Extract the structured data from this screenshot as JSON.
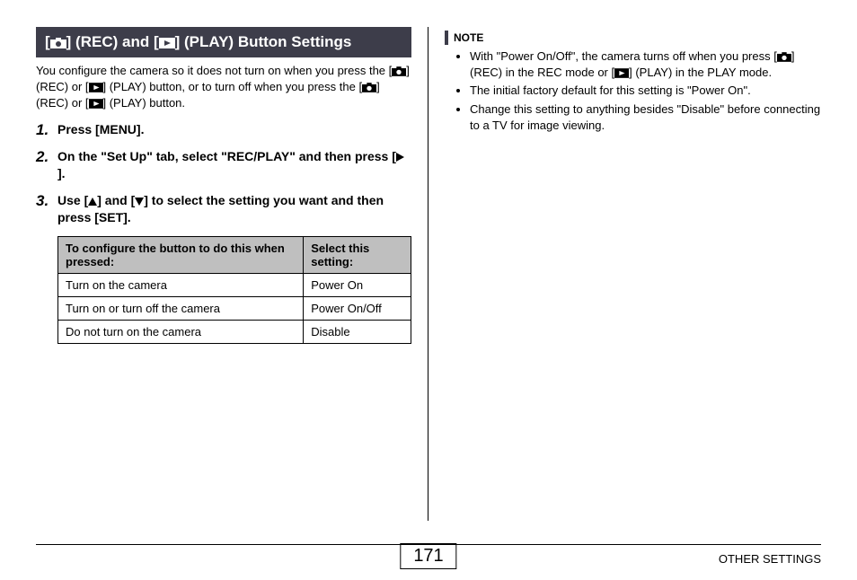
{
  "header": {
    "prefix": "[",
    "mid1": "] (REC) and [",
    "mid2": "] (PLAY) Button Settings"
  },
  "intro": {
    "p1a": "You configure the camera so it does not turn on when you press the [",
    "p1b": "] (REC) or [",
    "p1c": "] (PLAY) button, or to turn off when you press the [",
    "p1d": "] (REC) or [",
    "p1e": "] (PLAY) button."
  },
  "steps": {
    "n1": "1.",
    "s1": "Press [MENU].",
    "n2": "2.",
    "s2a": "On the \"Set Up\" tab, select \"REC/PLAY\" and then press [",
    "s2b": "].",
    "n3": "3.",
    "s3a": "Use [",
    "s3b": "] and [",
    "s3c": "] to select the setting you want and then press [SET]."
  },
  "table": {
    "h1": "To configure the button to do this when pressed:",
    "h2": "Select this setting:",
    "r1c1": "Turn on the camera",
    "r1c2": "Power On",
    "r2c1": "Turn on or turn off the camera",
    "r2c2": "Power On/Off",
    "r3c1": "Do not turn on the camera",
    "r3c2": "Disable"
  },
  "note": {
    "label": "NOTE",
    "i1a": "With \"Power On/Off\", the camera turns off when you press [",
    "i1b": "] (REC) in the REC mode or [",
    "i1c": "] (PLAY) in the PLAY mode.",
    "i2": "The initial factory default for this setting is \"Power On\".",
    "i3": "Change this setting to anything besides \"Disable\" before connecting to a TV for image viewing."
  },
  "footer": {
    "page": "171",
    "section": "OTHER SETTINGS"
  }
}
